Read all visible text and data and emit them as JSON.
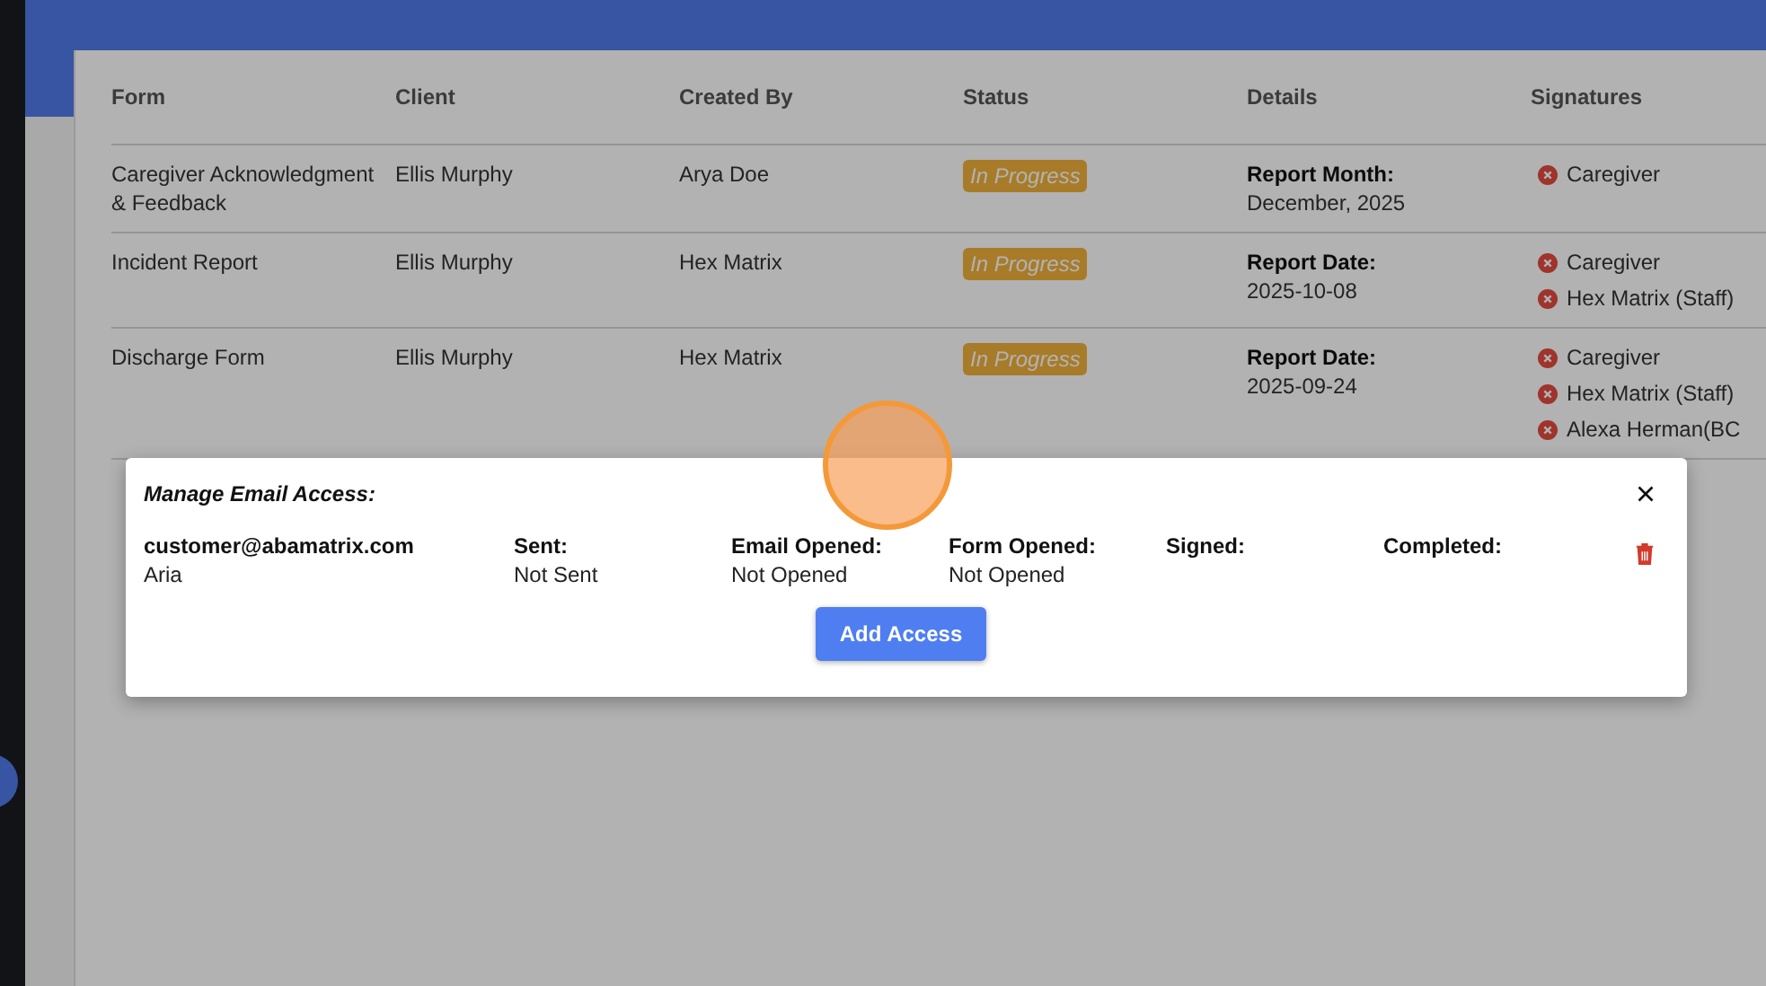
{
  "table": {
    "columns": [
      "Form",
      "Client",
      "Created By",
      "Status",
      "Details",
      "Signatures"
    ],
    "rows": [
      {
        "form": "Caregiver Acknowledgment & Feedback",
        "client": "Ellis Murphy",
        "created_by": "Arya Doe",
        "status": "In Progress",
        "details": {
          "label": "Report Month:",
          "value": "December, 2025"
        },
        "signatures": [
          {
            "name": "Caregiver",
            "signed": false
          }
        ]
      },
      {
        "form": "Incident Report",
        "client": "Ellis Murphy",
        "created_by": "Hex Matrix",
        "status": "In Progress",
        "details": {
          "label": "Report Date:",
          "value": "2025-10-08"
        },
        "signatures": [
          {
            "name": "Caregiver",
            "signed": false
          },
          {
            "name": "Hex Matrix (Staff)",
            "signed": false
          }
        ]
      },
      {
        "form": "Discharge Form",
        "client": "Ellis Murphy",
        "created_by": "Hex Matrix",
        "status": "In Progress",
        "details": {
          "label": "Report Date:",
          "value": "2025-09-24"
        },
        "signatures": [
          {
            "name": "Caregiver",
            "signed": false
          },
          {
            "name": "Hex Matrix (Staff)",
            "signed": false
          },
          {
            "name": "Alexa Herman(BC",
            "signed": false
          }
        ]
      }
    ]
  },
  "modal": {
    "title": "Manage Email Access:",
    "entries": [
      {
        "email": "customer@abamatrix.com",
        "name": "Aria",
        "fields": [
          {
            "label": "Sent:",
            "value": "Not Sent"
          },
          {
            "label": "Email Opened:",
            "value": "Not Opened"
          },
          {
            "label": "Form Opened:",
            "value": "Not Opened"
          },
          {
            "label": "Signed:"
          },
          {
            "label": "Completed:"
          }
        ]
      }
    ],
    "button": "Add Access"
  }
}
